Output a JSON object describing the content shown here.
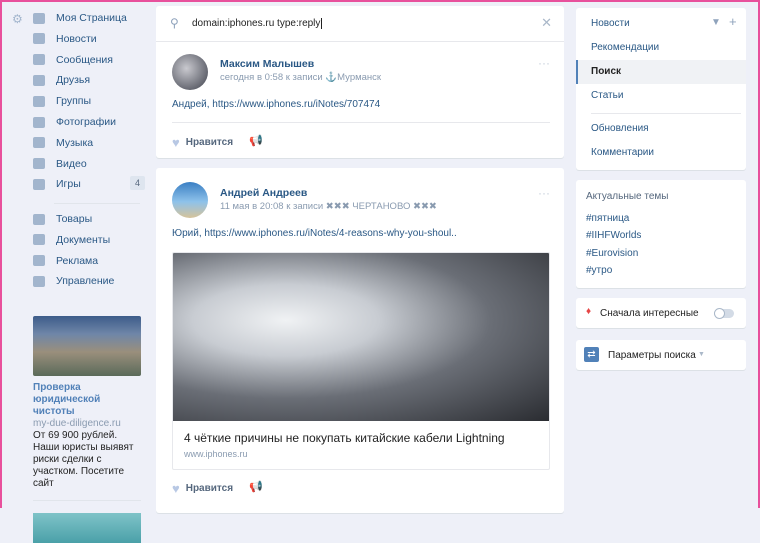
{
  "left_nav": {
    "items": [
      {
        "label": "Моя Страница",
        "icon": "home-icon"
      },
      {
        "label": "Новости",
        "icon": "news-icon"
      },
      {
        "label": "Сообщения",
        "icon": "messages-icon"
      },
      {
        "label": "Друзья",
        "icon": "friends-icon"
      },
      {
        "label": "Группы",
        "icon": "groups-icon"
      },
      {
        "label": "Фотографии",
        "icon": "camera-icon"
      },
      {
        "label": "Музыка",
        "icon": "music-icon"
      },
      {
        "label": "Видео",
        "icon": "video-icon"
      },
      {
        "label": "Игры",
        "icon": "games-icon",
        "badge": "4"
      }
    ],
    "items2": [
      {
        "label": "Товары",
        "icon": "bag-icon"
      },
      {
        "label": "Документы",
        "icon": "document-icon"
      },
      {
        "label": "Реклама",
        "icon": "megaphone-icon"
      },
      {
        "label": "Управление",
        "icon": "gamepad-icon"
      }
    ]
  },
  "ad": {
    "title": "Проверка юридической чистоты",
    "domain": "my-due-diligence.ru",
    "text": "От 69 900 рублей. Наши юристы выявят риски сделки с участком. Посетите сайт"
  },
  "search": {
    "value": "domain:iphones.ru type:reply"
  },
  "posts": [
    {
      "author": "Максим Малышев",
      "meta": "сегодня в 0:58 к записи ⚓Мурманск",
      "text": "Андрей, https://www.iphones.ru/iNotes/707474",
      "like": "Нравится"
    },
    {
      "author": "Андрей Андреев",
      "meta": "11 мая в 20:08 к записи ✖✖✖ ЧЕРТАНОВО ✖✖✖",
      "text": "Юрий, https://www.iphones.ru/iNotes/4-reasons-why-you-shoul..",
      "link_title": "4 чёткие причины не покупать китайские кабели Lightning",
      "link_domain": "www.iphones.ru",
      "like": "Нравится"
    }
  ],
  "right_menu": {
    "items": [
      "Новости",
      "Рекомендации",
      "Поиск",
      "Статьи"
    ],
    "items2": [
      "Обновления",
      "Комментарии"
    ],
    "active": "Поиск"
  },
  "topics": {
    "title": "Актуальные темы",
    "items": [
      "#пятница",
      "#IIHFWorlds",
      "#Eurovision",
      "#утро"
    ]
  },
  "interesting": {
    "label": "Сначала интересные",
    "enabled": false
  },
  "search_params": {
    "label": "Параметры поиска"
  },
  "colors": {
    "accent": "#5181b8",
    "link": "#2a5885",
    "frame": "#e8509c"
  }
}
